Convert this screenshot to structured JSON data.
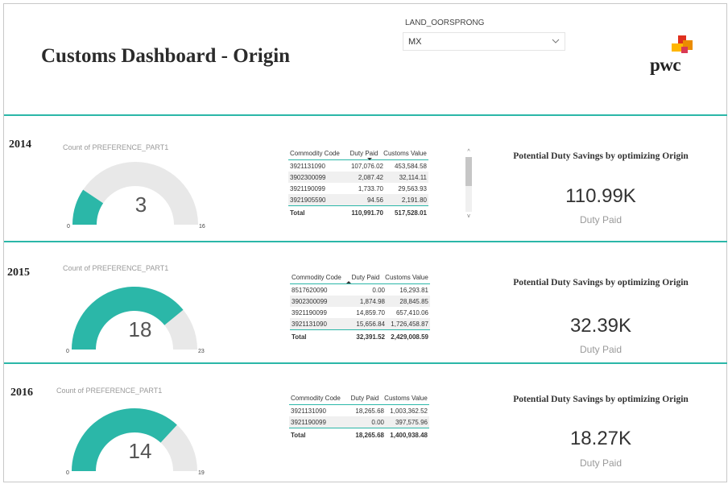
{
  "header": {
    "title": "Customs Dashboard - Origin",
    "filter": {
      "label": "LAND_OORSPRONG",
      "value": "MX"
    },
    "logo_text": "pwc"
  },
  "colors": {
    "accent": "#2bb7a8",
    "gauge_track": "#e8e8e8"
  },
  "table_columns": [
    "Commodity Code",
    "Duty Paid",
    "Customs Value"
  ],
  "sections": [
    {
      "year": "2014",
      "gauge": {
        "title": "Count of PREFERENCE_PART1",
        "value": 3,
        "value_label": "3",
        "min_label": "0",
        "max_label": "16",
        "max": 16
      },
      "table": {
        "rows": [
          [
            "3921131090",
            "107,076.02",
            "453,584.58"
          ],
          [
            "3902300099",
            "2,087.42",
            "32,114.11"
          ],
          [
            "3921190099",
            "1,733.70",
            "29,563.93"
          ],
          [
            "3921905590",
            "94.56",
            "2,191.80"
          ]
        ],
        "total": [
          "Total",
          "110,991.70",
          "517,528.01"
        ]
      },
      "kpi": {
        "title": "Potential Duty Savings by optimizing Origin",
        "value": "110.99K",
        "label": "Duty Paid"
      }
    },
    {
      "year": "2015",
      "gauge": {
        "title": "Count of PREFERENCE_PART1",
        "value": 18,
        "value_label": "18",
        "min_label": "0",
        "max_label": "23",
        "max": 23
      },
      "table": {
        "rows": [
          [
            "8517620090",
            "0.00",
            "16,293.81"
          ],
          [
            "3902300099",
            "1,874.98",
            "28,845.85"
          ],
          [
            "3921190099",
            "14,859.70",
            "657,410.06"
          ],
          [
            "3921131090",
            "15,656.84",
            "1,726,458.87"
          ]
        ],
        "total": [
          "Total",
          "32,391.52",
          "2,429,008.59"
        ]
      },
      "kpi": {
        "title": "Potential Duty Savings by optimizing Origin",
        "value": "32.39K",
        "label": "Duty Paid"
      }
    },
    {
      "year": "2016",
      "gauge": {
        "title": "Count of PREFERENCE_PART1",
        "value": 14,
        "value_label": "14",
        "min_label": "0",
        "max_label": "19",
        "max": 19
      },
      "table": {
        "rows": [
          [
            "3921131090",
            "18,265.68",
            "1,003,362.52"
          ],
          [
            "3921190099",
            "0.00",
            "397,575.96"
          ]
        ],
        "total": [
          "Total",
          "18,265.68",
          "1,400,938.48"
        ]
      },
      "kpi": {
        "title": "Potential Duty Savings by optimizing Origin",
        "value": "18.27K",
        "label": "Duty Paid"
      }
    }
  ]
}
